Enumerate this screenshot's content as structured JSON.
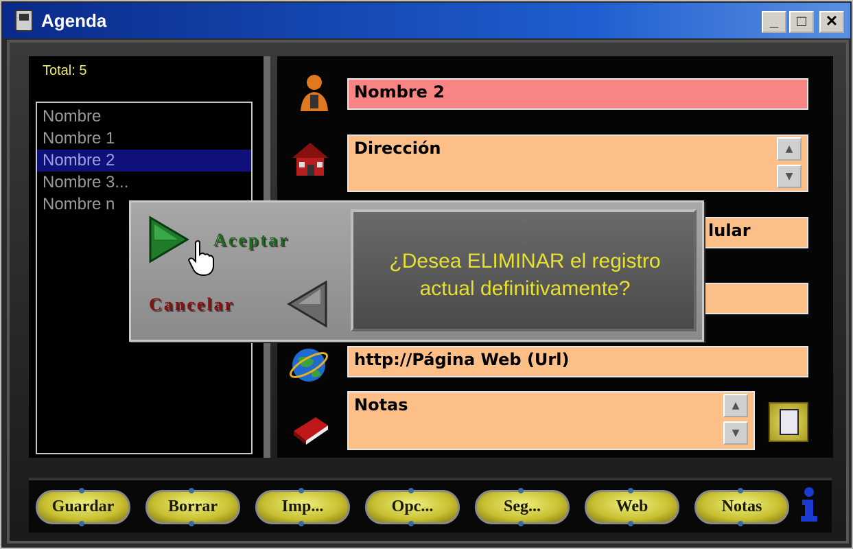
{
  "window": {
    "title": "Agenda"
  },
  "titlebar": {
    "minimize": "_",
    "maximize": "□",
    "close": "✕"
  },
  "list": {
    "total": "Total: 5",
    "items": [
      "Nombre",
      "Nombre 1",
      "Nombre 2",
      "Nombre 3...",
      "Nombre n"
    ],
    "selected_index": 2
  },
  "form": {
    "name": "Nombre 2",
    "address": "Dirección",
    "cellphone_partial": "lular",
    "web": "http://Página Web (Url)",
    "notes": "Notas"
  },
  "dialog": {
    "message": "¿Desea ELIMINAR el registro actual definitivamente?",
    "accept": "Aceptar",
    "cancel": "Cancelar"
  },
  "toolbar": {
    "buttons": [
      "Guardar",
      "Borrar",
      "Imp...",
      "Opc...",
      "Seg...",
      "Web",
      "Notas"
    ]
  },
  "colors": {
    "name_field": "#f98484",
    "field": "#fdbf88",
    "message_text": "#e8e030",
    "total_text": "#f2ee60"
  }
}
